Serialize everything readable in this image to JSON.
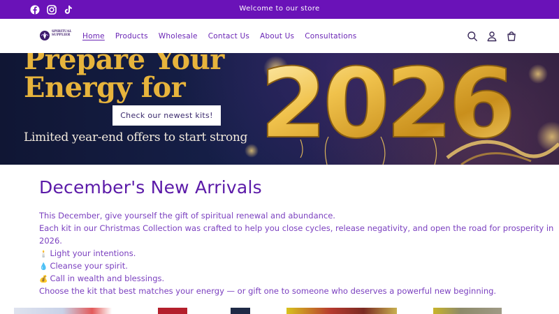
{
  "announcement": {
    "text": "Welcome to our store",
    "social": [
      "facebook-icon",
      "instagram-icon",
      "tiktok-icon"
    ]
  },
  "header": {
    "logo_text_1": "SPIRITUAL",
    "logo_text_2": "SUPPLIER",
    "nav": [
      {
        "label": "Home",
        "active": true
      },
      {
        "label": "Products"
      },
      {
        "label": "Wholesale"
      },
      {
        "label": "Contact Us"
      },
      {
        "label": "About Us"
      },
      {
        "label": "Consultations"
      }
    ],
    "icons": [
      "search-icon",
      "account-icon",
      "cart-icon"
    ]
  },
  "hero": {
    "line1": "Prepare Your",
    "line2": "Energy for",
    "year": "2026",
    "button_label": "Check our newest kits!",
    "subtitle": "Limited year-end offers to start strong"
  },
  "content": {
    "title": "December's New Arrivals",
    "intro": "This December, give yourself the gift of spiritual renewal and abundance.",
    "body_line1": "Each kit in our Christmas Collection was crafted to help you close cycles, release negativity, and open the road for prosperity in",
    "body_line2": "2026.",
    "items": [
      {
        "emoji": "🕯️",
        "text": "Light your intentions."
      },
      {
        "emoji": "💧",
        "text": "Cleanse your spirit."
      },
      {
        "emoji": "💰",
        "text": "Call in wealth and blessings."
      }
    ],
    "closing": "Choose the kit that best matches your energy — or gift one to someone who deserves a powerful new beginning."
  },
  "colors": {
    "brand_purple": "#6a12b8",
    "text_purple": "#5b1aa8",
    "gold": "#e7b43c",
    "hero_navy": "#16204a"
  }
}
